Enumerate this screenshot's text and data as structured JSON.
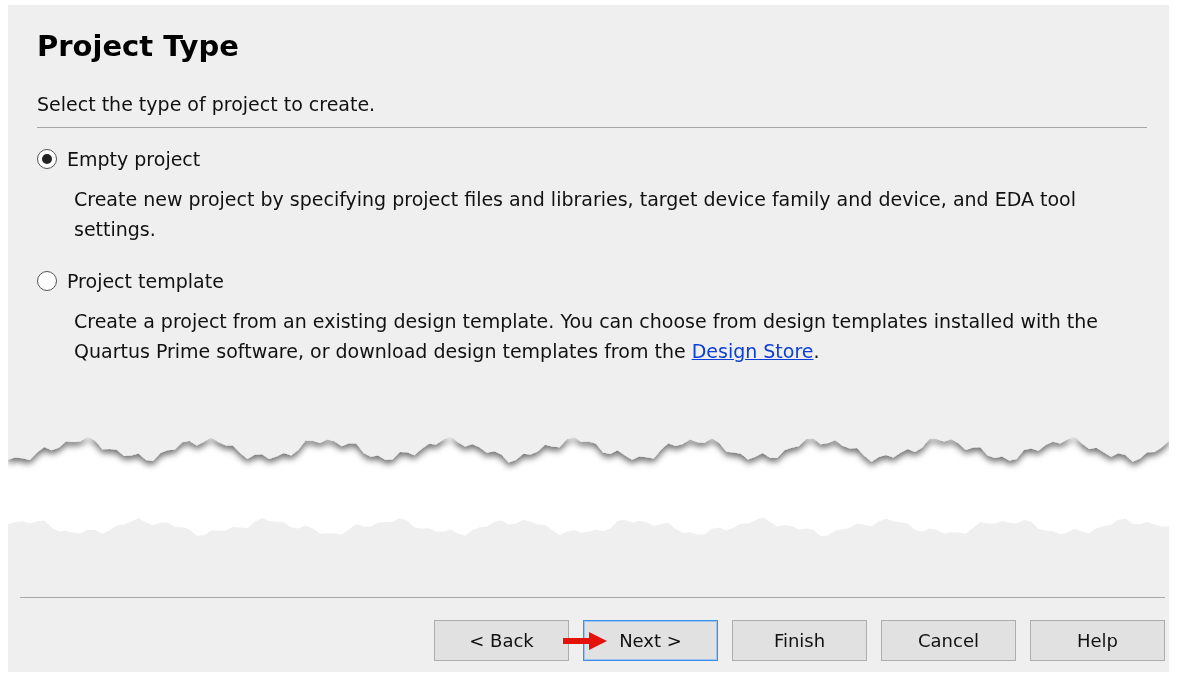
{
  "page": {
    "title": "Project Type",
    "subtitle": "Select the type of project to create."
  },
  "options": [
    {
      "label": "Empty project",
      "selected": true,
      "description": "Create new project by specifying project files and libraries, target device family and device, and EDA tool settings."
    },
    {
      "label": "Project template",
      "selected": false,
      "description": "Create a project from an existing design template. You can choose from design templates installed with the Quartus Prime software, or download design templates from the ",
      "link": "Design Store",
      "after_link": "."
    }
  ],
  "buttons": [
    {
      "label": "< Back",
      "focused": false
    },
    {
      "label": "Next >",
      "focused": true
    },
    {
      "label": "Finish",
      "focused": false
    },
    {
      "label": "Cancel",
      "focused": false
    },
    {
      "label": "Help",
      "focused": false
    }
  ],
  "annotation": {
    "kind": "arrow"
  }
}
